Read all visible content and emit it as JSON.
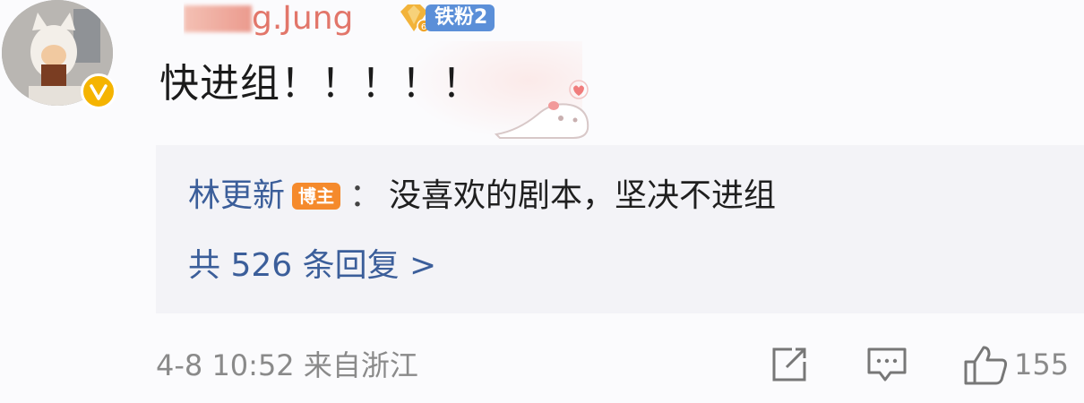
{
  "comment": {
    "username_visible": "g.Jung",
    "fan_badge": {
      "level": "6",
      "label": "铁粉2"
    },
    "text": "快进组！！！！！",
    "sticker_icon": "cat-heart-sticker"
  },
  "reply": {
    "author": "林更新",
    "author_badge": "博主",
    "separator": "：",
    "text": "没喜欢的剧本，坚决不进组",
    "count_label": "共 526 条回复 >"
  },
  "footer": {
    "time_location": "4-8 10:52 来自浙江",
    "actions": [
      {
        "name": "share",
        "icon": "share-icon"
      },
      {
        "name": "comment",
        "icon": "comment-icon"
      },
      {
        "name": "like",
        "icon": "thumbs-up-icon"
      }
    ],
    "like_count": "155"
  },
  "colors": {
    "link_blue": "#3b5e9a",
    "username": "#e2766a",
    "blogger_badge": "#f58a2c",
    "fan_badge": "#5b8fd8",
    "reply_bg": "#f3f3f7",
    "meta_gray": "#8a8a8a",
    "verified": "#f5b400"
  }
}
